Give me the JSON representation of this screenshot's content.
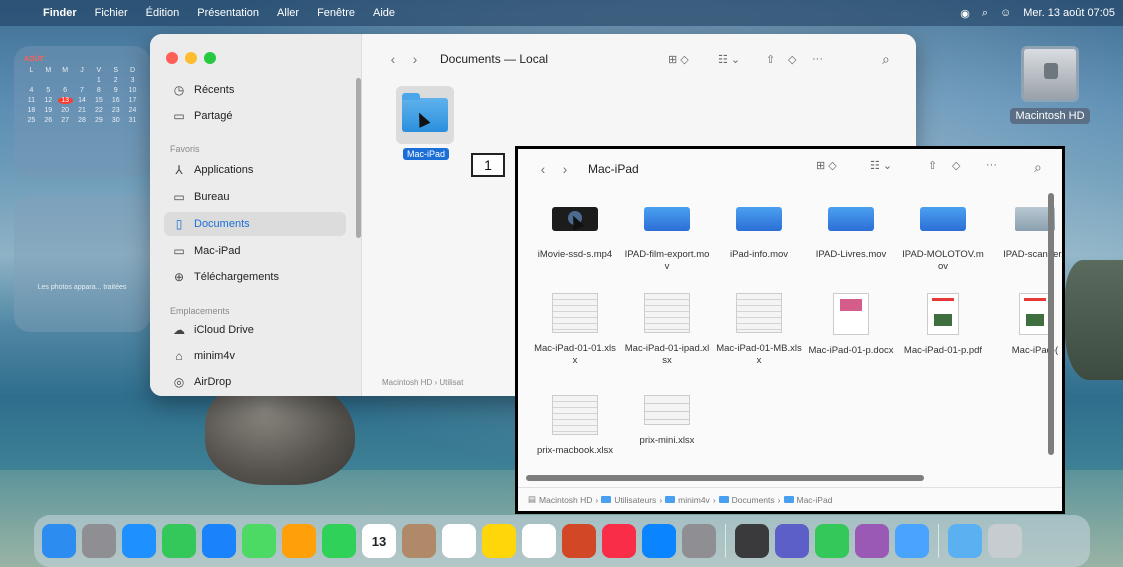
{
  "menubar": {
    "app": "Finder",
    "items": [
      "Fichier",
      "Édition",
      "Présentation",
      "Aller",
      "Fenêtre",
      "Aide"
    ],
    "datetime": "Mer. 13 août 07:05"
  },
  "calendar_widget": {
    "month": "AOÛT",
    "weekdays": [
      "L",
      "M",
      "M",
      "J",
      "V",
      "S",
      "D"
    ],
    "days": [
      "",
      "",
      "",
      "",
      "1",
      "2",
      "3",
      "4",
      "5",
      "6",
      "7",
      "8",
      "9",
      "10",
      "11",
      "12",
      "13",
      "14",
      "15",
      "16",
      "17",
      "18",
      "19",
      "20",
      "21",
      "22",
      "23",
      "24",
      "25",
      "26",
      "27",
      "28",
      "29",
      "30",
      "31"
    ],
    "today": "13"
  },
  "photos_widget": {
    "text": "Les photos appara... traitées"
  },
  "desktop": {
    "hd_label": "Macintosh HD"
  },
  "back_window": {
    "title": "Documents — Local",
    "sidebar": {
      "items_top": [
        {
          "label": "Récents",
          "icon": "clock-icon"
        },
        {
          "label": "Partagé",
          "icon": "shared-folder-icon"
        }
      ],
      "favorites_header": "Favoris",
      "favorites": [
        {
          "label": "Applications",
          "icon": "applications-icon"
        },
        {
          "label": "Bureau",
          "icon": "desktop-icon"
        },
        {
          "label": "Documents",
          "icon": "document-icon",
          "active": true
        },
        {
          "label": "Mac-iPad",
          "icon": "folder-icon"
        },
        {
          "label": "Téléchargements",
          "icon": "download-icon"
        }
      ],
      "locations_header": "Emplacements",
      "locations": [
        {
          "label": "iCloud Drive",
          "icon": "cloud-icon"
        },
        {
          "label": "minim4v",
          "icon": "home-icon"
        },
        {
          "label": "AirDrop",
          "icon": "airdrop-icon"
        }
      ]
    },
    "folder_label": "Mac-iPad",
    "pathbar": "Macintosh HD › Utilisat"
  },
  "callout": "1",
  "front_window": {
    "title": "Mac-iPad",
    "files": [
      {
        "name": "iMovie-ssd-s.mp4",
        "thumb": "video"
      },
      {
        "name": "IPAD-film-export.mov",
        "thumb": "blue"
      },
      {
        "name": "iPad-info.mov",
        "thumb": "blue"
      },
      {
        "name": "IPAD-Livres.mov",
        "thumb": "blue"
      },
      {
        "name": "IPAD-MOLOTOV.mov",
        "thumb": "blue"
      },
      {
        "name": "IPAD-scanner.r",
        "thumb": "scan"
      },
      {
        "name": "Mac-iPad-01-01.xlsx",
        "thumb": "sheet"
      },
      {
        "name": "Mac-iPad-01-ipad.xlsx",
        "thumb": "sheet"
      },
      {
        "name": "Mac-iPad-01-MB.xlsx",
        "thumb": "sheet"
      },
      {
        "name": "Mac-iPad-01-p.docx",
        "thumb": "doc"
      },
      {
        "name": "Mac-iPad-01-p.pdf",
        "thumb": "pdf"
      },
      {
        "name": "Mac-iPad-(",
        "thumb": "pdf"
      },
      {
        "name": "prix-macbook.xlsx",
        "thumb": "sheet"
      },
      {
        "name": "prix-mini.xlsx",
        "thumb": "mini"
      }
    ],
    "pathbar": [
      "Macintosh HD",
      "Utilisateurs",
      "minim4v",
      "Documents",
      "Mac-iPad"
    ]
  },
  "dock": {
    "calendar_day": "13",
    "icons": [
      {
        "name": "finder-icon",
        "color": "#2d8cf0"
      },
      {
        "name": "launchpad-icon",
        "color": "#8e8e93"
      },
      {
        "name": "safari-icon",
        "color": "#1e90ff"
      },
      {
        "name": "messages-icon",
        "color": "#34c759"
      },
      {
        "name": "mail-icon",
        "color": "#1a82fb"
      },
      {
        "name": "maps-icon",
        "color": "#4cd964"
      },
      {
        "name": "photos-icon",
        "color": "#ff9f0a"
      },
      {
        "name": "facetime-icon",
        "color": "#30d158"
      },
      {
        "name": "calendar-icon",
        "color": "#ffffff"
      },
      {
        "name": "contacts-icon",
        "color": "#b08968"
      },
      {
        "name": "reminders-icon",
        "color": "#ffffff"
      },
      {
        "name": "notes-icon",
        "color": "#ffd60a"
      },
      {
        "name": "freeform-icon",
        "color": "#ffffff"
      },
      {
        "name": "powerpoint-icon",
        "color": "#d24726"
      },
      {
        "name": "music-icon",
        "color": "#fa2d48"
      },
      {
        "name": "appstore-icon",
        "color": "#0a84ff"
      },
      {
        "name": "settings-icon",
        "color": "#8e8e93"
      },
      {
        "name": "migration-icon",
        "color": "#3a3a3c"
      },
      {
        "name": "teams-icon",
        "color": "#5b5fc7"
      },
      {
        "name": "app-icon",
        "color": "#34c759"
      },
      {
        "name": "podcast-icon",
        "color": "#9b59b6"
      },
      {
        "name": "weather-icon",
        "color": "#4aa3ff"
      },
      {
        "name": "downloads-folder-icon",
        "color": "#5ab0f0"
      },
      {
        "name": "trash-icon",
        "color": "#c7ccd1"
      }
    ]
  }
}
